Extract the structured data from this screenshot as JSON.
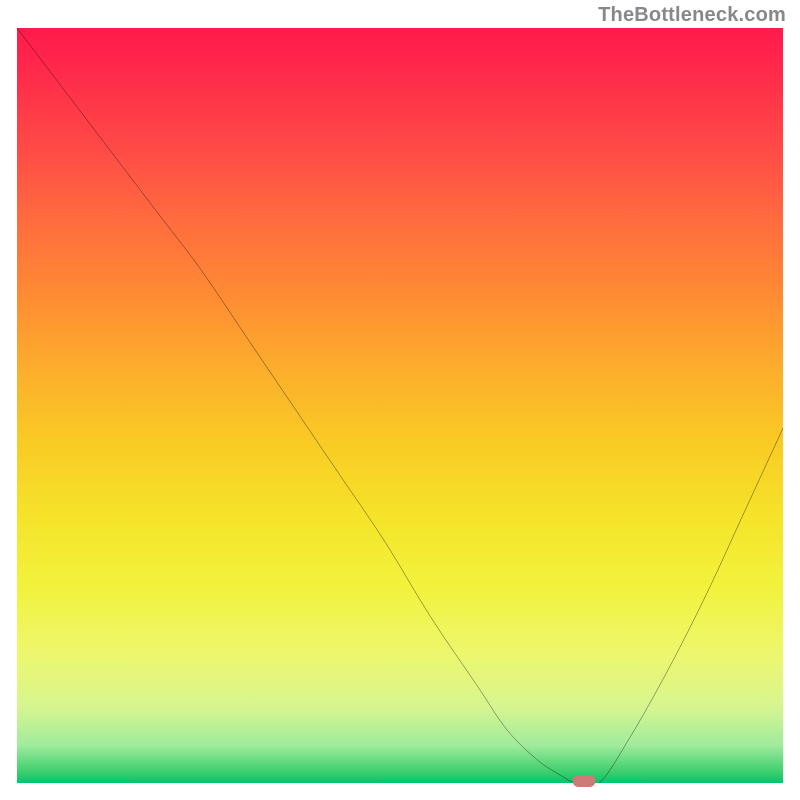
{
  "watermark": "TheBottleneck.com",
  "chart_data": {
    "type": "line",
    "title": "",
    "xlabel": "",
    "ylabel": "",
    "xlim": [
      0,
      100
    ],
    "ylim": [
      0,
      100
    ],
    "grid": false,
    "legend": false,
    "background_gradient": {
      "direction": "vertical",
      "stops": [
        {
          "pos": 0,
          "color": "#ff1a4d"
        },
        {
          "pos": 0.15,
          "color": "#ff4747"
        },
        {
          "pos": 0.35,
          "color": "#ff8a34"
        },
        {
          "pos": 0.55,
          "color": "#f9cb24"
        },
        {
          "pos": 0.74,
          "color": "#f2f23c"
        },
        {
          "pos": 0.9,
          "color": "#d6f590"
        },
        {
          "pos": 1.0,
          "color": "#00c76c"
        }
      ]
    },
    "series": [
      {
        "name": "bottleneck-curve",
        "color": "#000000",
        "x": [
          0,
          6,
          12,
          18,
          24,
          30,
          36,
          42,
          48,
          54,
          60,
          64,
          68,
          71,
          73,
          76,
          80,
          85,
          90,
          95,
          100
        ],
        "y": [
          100,
          92,
          84,
          76,
          68,
          59,
          50,
          41,
          32,
          22,
          13,
          7,
          3,
          1,
          0,
          0,
          6,
          15,
          25,
          36,
          47
        ]
      }
    ],
    "marker": {
      "name": "optimal-point",
      "x": 74.0,
      "y": 0.3,
      "color": "#cd7a78"
    }
  }
}
